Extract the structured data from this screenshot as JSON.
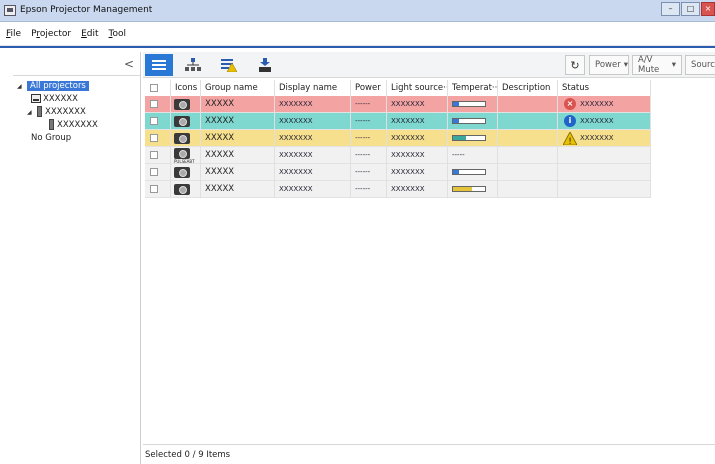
{
  "window": {
    "title": "Epson Projector Management",
    "app_icon": "projector-app-icon"
  },
  "menubar": {
    "items": [
      {
        "label": "File",
        "accel": "F"
      },
      {
        "label": "Projector",
        "accel": "r"
      },
      {
        "label": "Edit",
        "accel": "E"
      },
      {
        "label": "Tool",
        "accel": "T"
      }
    ]
  },
  "sidebar": {
    "collapse_glyph": "<",
    "tree": [
      {
        "label": "All projectors",
        "level": 0,
        "expander": "◢",
        "icon": "",
        "selected": true
      },
      {
        "label": "XXXXXX",
        "level": 1,
        "expander": "",
        "icon": "projector",
        "selected": false
      },
      {
        "label": "XXXXXXX",
        "level": 1,
        "expander": "◢",
        "icon": "group",
        "selected": false
      },
      {
        "label": "XXXXXXX",
        "level": 2,
        "expander": "",
        "icon": "group",
        "selected": false
      },
      {
        "label": "No Group",
        "level": 1,
        "expander": "",
        "icon": "",
        "selected": false
      }
    ]
  },
  "toolbar": {
    "view_buttons": [
      {
        "name": "list-view-icon",
        "active": true
      },
      {
        "name": "group-view-icon",
        "active": false
      },
      {
        "name": "alert-list-icon",
        "active": false
      },
      {
        "name": "download-icon",
        "active": false
      }
    ],
    "refresh_glyph": "↻",
    "power_label": "Power",
    "av_mute_label": "A/V Mute",
    "source_label": "Source",
    "dropdown_glyph": "▾"
  },
  "table": {
    "headers": [
      "",
      "Icons",
      "Group name",
      "Display name",
      "Power",
      "Light source···",
      "Temperat···",
      "Description",
      "Status"
    ],
    "rows": [
      {
        "state": "error",
        "group": "XXXXX",
        "display": "XXXXXXX",
        "power": "------",
        "light": "XXXXXXX",
        "temp_fill": 0.2,
        "temp_color": "#3a78d8",
        "temp_text": "",
        "desc": "",
        "status_icon": "error",
        "status_text": "XXXXXXX",
        "icon_sub": ""
      },
      {
        "state": "info",
        "group": "XXXXX",
        "display": "XXXXXXX",
        "power": "------",
        "light": "XXXXXXX",
        "temp_fill": 0.2,
        "temp_color": "#3a78d8",
        "temp_text": "",
        "desc": "",
        "status_icon": "info",
        "status_text": "XXXXXXX",
        "icon_sub": ""
      },
      {
        "state": "warning",
        "group": "XXXXX",
        "display": "XXXXXXX",
        "power": "------",
        "light": "XXXXXXX",
        "temp_fill": 0.4,
        "temp_color": "#3aa89c",
        "temp_text": "",
        "desc": "",
        "status_icon": "warning",
        "status_text": "XXXXXXX",
        "icon_sub": ""
      },
      {
        "state": "normal",
        "group": "XXXXX",
        "display": "XXXXXXX",
        "power": "------",
        "light": "XXXXXXX",
        "temp_fill": null,
        "temp_color": "",
        "temp_text": "-----",
        "desc": "",
        "status_icon": "",
        "status_text": "",
        "icon_sub": "PULSEABT"
      },
      {
        "state": "normal",
        "group": "XXXXX",
        "display": "XXXXXXX",
        "power": "------",
        "light": "XXXXXXX",
        "temp_fill": 0.2,
        "temp_color": "#3a78d8",
        "temp_text": "",
        "desc": "",
        "status_icon": "",
        "status_text": "",
        "icon_sub": ""
      },
      {
        "state": "normal",
        "group": "XXXXX",
        "display": "XXXXXXX",
        "power": "------",
        "light": "XXXXXXX",
        "temp_fill": 0.6,
        "temp_color": "#e6c43a",
        "temp_text": "",
        "desc": "",
        "status_icon": "",
        "status_text": "",
        "icon_sub": ""
      }
    ]
  },
  "statusbar": {
    "text": "Selected  0 / 9  Items"
  },
  "colors": {
    "accent": "#2a78d6",
    "error_row": "#f4a3a3",
    "info_row": "#7ed8cf",
    "warning_row": "#f6df8d",
    "error_icon": "#d9534f",
    "info_icon": "#1f64c8",
    "warning_icon": "#e8c000"
  }
}
